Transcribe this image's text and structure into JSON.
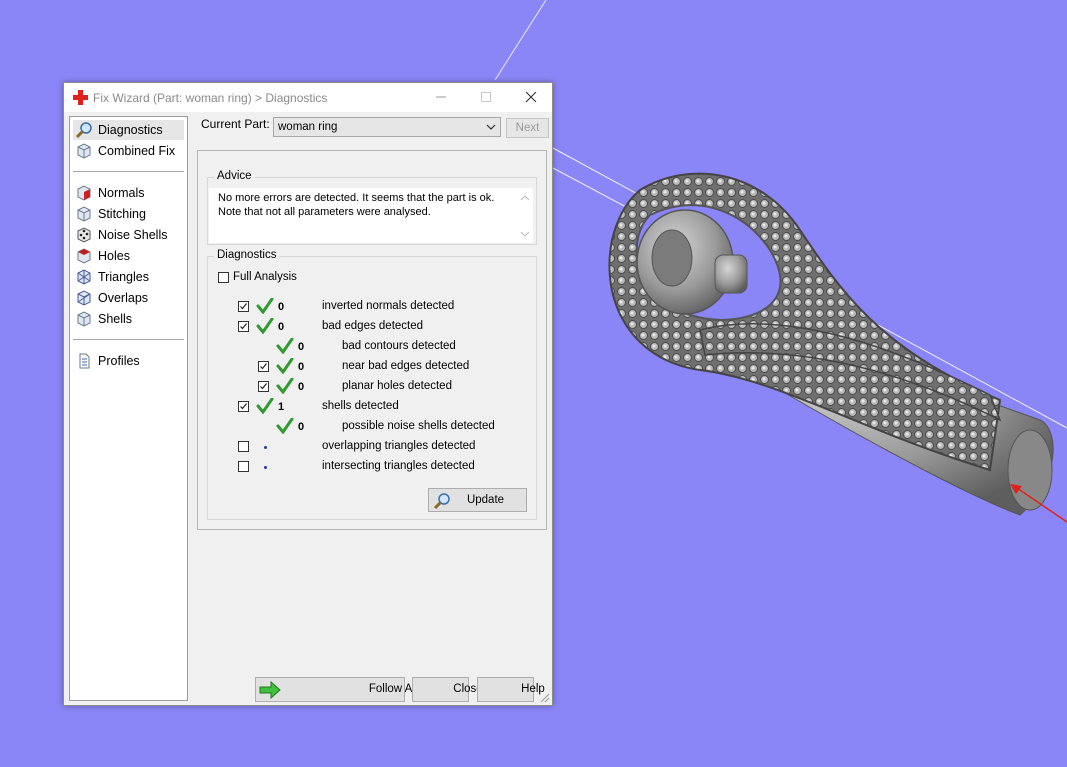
{
  "window": {
    "title": "Fix Wizard (Part: woman ring) > Diagnostics"
  },
  "sidebar": {
    "items": [
      {
        "label": "Diagnostics",
        "icon": "magnifier-icon",
        "selected": true
      },
      {
        "label": "Combined Fix",
        "icon": "cube-icon",
        "selected": false
      },
      {
        "label": "Normals",
        "icon": "normals-cube-icon",
        "selected": false
      },
      {
        "label": "Stitching",
        "icon": "stitching-cube-icon",
        "selected": false
      },
      {
        "label": "Noise Shells",
        "icon": "noise-cube-icon",
        "selected": false
      },
      {
        "label": "Holes",
        "icon": "holes-cube-icon",
        "selected": false
      },
      {
        "label": "Triangles",
        "icon": "triangles-cube-icon",
        "selected": false
      },
      {
        "label": "Overlaps",
        "icon": "overlaps-cube-icon",
        "selected": false
      },
      {
        "label": "Shells",
        "icon": "shells-cube-icon",
        "selected": false
      },
      {
        "label": "Profiles",
        "icon": "document-icon",
        "selected": false
      }
    ]
  },
  "current_part": {
    "label": "Current Part:",
    "value": "woman ring",
    "next_label": "Next"
  },
  "advice": {
    "title": "Advice",
    "line1": "No more errors are detected. It seems that the part is ok.",
    "line2": "Note that not all parameters were analysed."
  },
  "diagnostics": {
    "title": "Diagnostics",
    "full_analysis_label": "Full Analysis",
    "full_analysis_checked": false,
    "rows": [
      {
        "label": "inverted normals detected",
        "value": "0",
        "checked": true,
        "status": "ok"
      },
      {
        "label": "bad edges detected",
        "value": "0",
        "checked": true,
        "status": "ok"
      },
      {
        "label": "bad contours detected",
        "value": "0",
        "checked": null,
        "status": "ok"
      },
      {
        "label": "near bad edges detected",
        "value": "0",
        "checked": true,
        "status": "ok"
      },
      {
        "label": "planar holes detected",
        "value": "0",
        "checked": true,
        "status": "ok"
      },
      {
        "label": "shells detected",
        "value": "1",
        "checked": true,
        "status": "ok"
      },
      {
        "label": "possible noise shells detected",
        "value": "0",
        "checked": null,
        "status": "ok"
      },
      {
        "label": "overlapping triangles detected",
        "value": "",
        "checked": false,
        "status": "not-run"
      },
      {
        "label": "intersecting triangles detected",
        "value": "",
        "checked": false,
        "status": "not-run"
      }
    ],
    "update_label": "Update"
  },
  "footer": {
    "follow_advice_label": "Follow Advice",
    "close_label": "Close",
    "help_label": "Help"
  },
  "colors": {
    "background": "#8b86f7",
    "tick_green": "#2e9b2e",
    "axis_red": "#e0201a",
    "mesh_gray": "#9a9a9a"
  }
}
